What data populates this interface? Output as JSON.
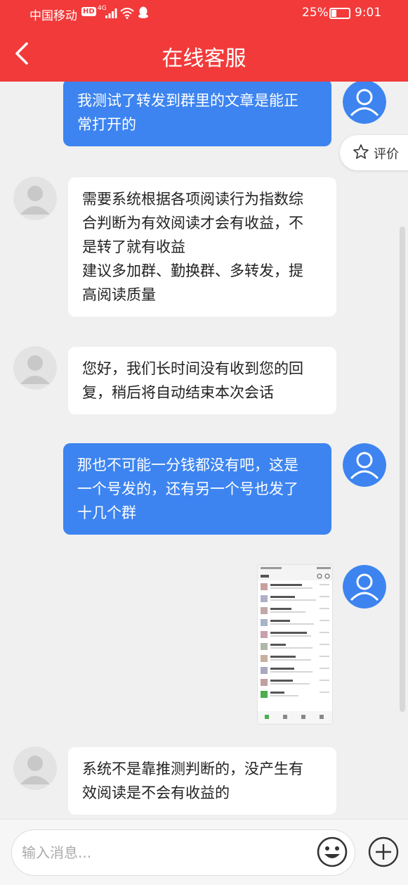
{
  "status_bar": {
    "carrier": "中国移动",
    "hd": "HD",
    "network": "4G",
    "battery_level": 0.25,
    "battery_percent": "25%",
    "time": "9:01"
  },
  "header": {
    "title": "在线客服",
    "background_color": "#f23a3a"
  },
  "rate_button": {
    "label": "评价",
    "icon": "star-icon"
  },
  "messages": [
    {
      "sender": "user",
      "lines": [
        "我测试了转发到群里的文章是能正",
        "常打开的"
      ]
    },
    {
      "sender": "agent",
      "lines": [
        "需要系统根据各项阅读行为指数综",
        "合判断为有效阅读才会有收益，不",
        "是转了就有收益",
        "建议多加群、勤换群、多转发，提",
        "高阅读质量"
      ]
    },
    {
      "sender": "agent",
      "lines": [
        "您好，我们长时间没有收到您的回",
        "复，稍后将自动结束本次会话"
      ]
    },
    {
      "sender": "user",
      "lines": [
        "那也不可能一分钱都没有吧，这是",
        "一个号发的，还有另一个号也发了",
        "十几个群"
      ]
    },
    {
      "sender": "user",
      "type": "image",
      "content": "wechat-chat-list-screenshot"
    },
    {
      "sender": "agent",
      "lines": [
        "系统不是靠推测判断的，没产生有",
        "效阅读是不会有收益的"
      ]
    }
  ],
  "input": {
    "placeholder": "输入消息..."
  },
  "colors": {
    "user_bubble": "#3d84f0",
    "agent_bubble": "#ffffff",
    "chat_background": "#f0f0f0"
  }
}
